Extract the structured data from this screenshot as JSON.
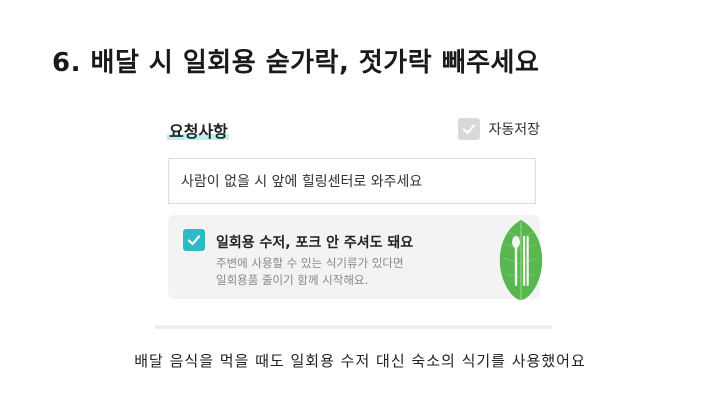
{
  "slide": {
    "title": "6. 배달 시 일회용 숟가락, 젓가락 빼주세요",
    "caption": "배달 음식을 먹을 때도 일회용 수저 대신 숙소의 식기를 사용했어요"
  },
  "request": {
    "section_title": "요청사항",
    "autosave_label": "자동저장",
    "autosave_checked": true,
    "input_value": "사람이 없을 시 앞에 힐링센터로 와주세요"
  },
  "utensil_option": {
    "label": "일회용 수저, 포크 안 주셔도 돼요",
    "desc_line1": "주변에 사용할 수 있는 식기류가 있다면",
    "desc_line2": "일회용품 줄이기 함께 시작해요.",
    "checked": true
  },
  "colors": {
    "accent": "#2bbcc4",
    "highlight": "#bdeef0",
    "leaf": "#5cb85c"
  },
  "icons": [
    "check-icon",
    "leaf-utensils-icon"
  ]
}
